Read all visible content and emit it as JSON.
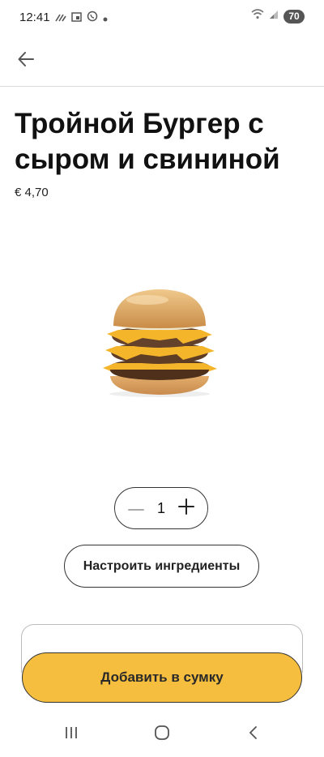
{
  "status_bar": {
    "time": "12:41",
    "battery_level": "70",
    "left_icons": [
      "signal-lines-icon",
      "calendar-icon",
      "viber-icon",
      "notification-dot-icon"
    ],
    "right_icons": [
      "wifi-icon",
      "cellular-signal-icon",
      "battery-icon"
    ]
  },
  "header": {
    "back_icon": "arrow-left-icon"
  },
  "product": {
    "title": "Тройной Бургер с сыром и свининой",
    "price": "€ 4,70",
    "image": "triple-cheeseburger-image"
  },
  "quantity": {
    "value": "1",
    "minus_icon": "minus-icon",
    "plus_icon": "plus-icon"
  },
  "actions": {
    "customize_label": "Настроить ингредиенты",
    "add_to_bag_label": "Добавить в сумку"
  },
  "nav_bar": {
    "icons": [
      "recent-apps-icon",
      "home-icon",
      "back-icon"
    ]
  },
  "colors": {
    "accent": "#f5be3e",
    "text": "#111111",
    "border": "#333333"
  }
}
